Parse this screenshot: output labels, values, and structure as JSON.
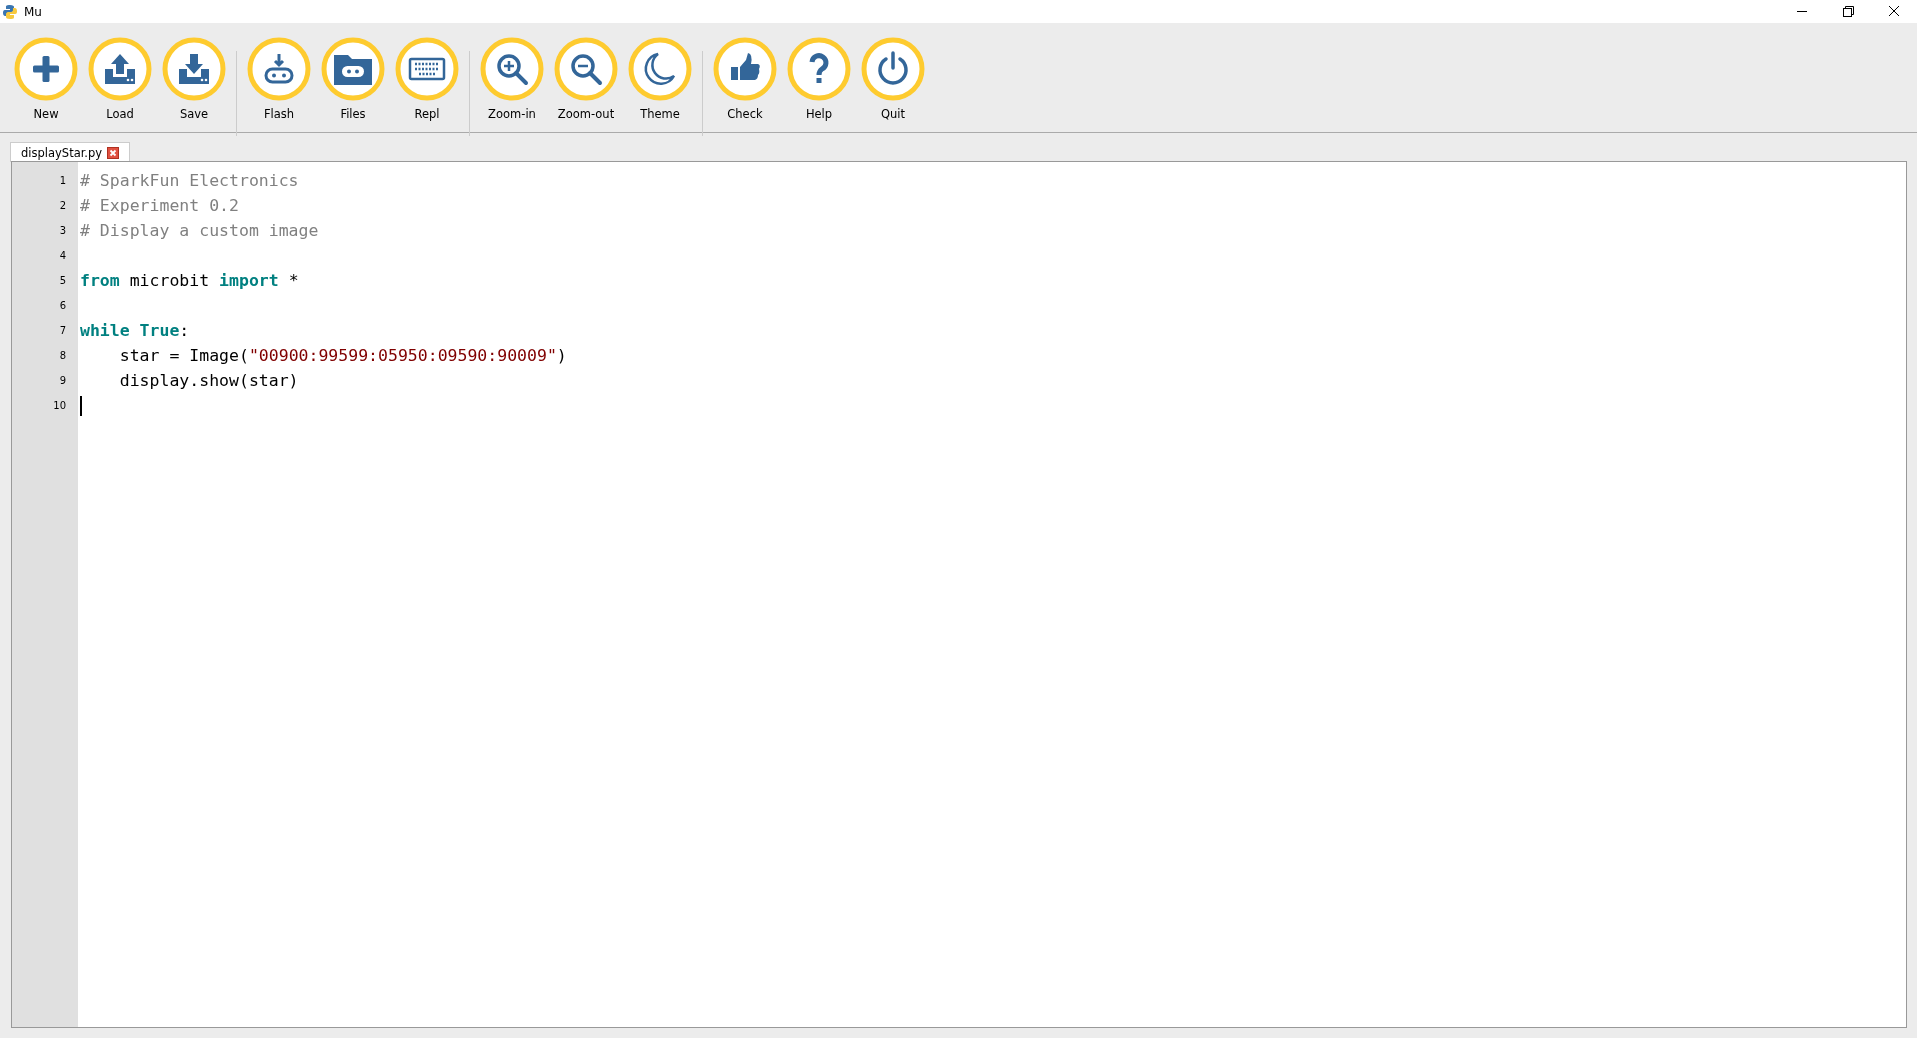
{
  "window": {
    "title": "Mu"
  },
  "toolbar": {
    "groups": [
      [
        {
          "label": "New"
        },
        {
          "label": "Load"
        },
        {
          "label": "Save"
        }
      ],
      [
        {
          "label": "Flash"
        },
        {
          "label": "Files"
        },
        {
          "label": "Repl"
        }
      ],
      [
        {
          "label": "Zoom-in"
        },
        {
          "label": "Zoom-out"
        },
        {
          "label": "Theme"
        }
      ],
      [
        {
          "label": "Check"
        },
        {
          "label": "Help"
        },
        {
          "label": "Quit"
        }
      ]
    ]
  },
  "tabs": [
    {
      "label": "displayStar.py",
      "selected": true
    }
  ],
  "editor": {
    "lines": [
      {
        "number": "1",
        "cursor": false,
        "tokens": [
          {
            "text": "# SparkFun Electronics",
            "kind": "comment"
          }
        ]
      },
      {
        "number": "2",
        "cursor": false,
        "tokens": [
          {
            "text": "# Experiment 0.2",
            "kind": "comment"
          }
        ]
      },
      {
        "number": "3",
        "cursor": false,
        "tokens": [
          {
            "text": "# Display a custom image",
            "kind": "comment"
          }
        ]
      },
      {
        "number": "4",
        "cursor": false
      },
      {
        "number": "5",
        "cursor": false,
        "tokens": [
          {
            "text": "from",
            "kind": "keyword"
          },
          {
            "text": " microbit ",
            "kind": "plain"
          },
          {
            "text": "import",
            "kind": "keyword"
          },
          {
            "text": " *",
            "kind": "plain"
          }
        ]
      },
      {
        "number": "6",
        "cursor": false
      },
      {
        "number": "7",
        "cursor": false,
        "tokens": [
          {
            "text": "while",
            "kind": "keyword"
          },
          {
            "text": " True",
            "kind": "keyword"
          },
          {
            "text": ":",
            "kind": "plain"
          }
        ]
      },
      {
        "number": "8",
        "cursor": false,
        "tokens": [
          {
            "text": "    star = Image(",
            "kind": "plain"
          },
          {
            "text": "\"00900:99599:05950:09590:90009\"",
            "kind": "string"
          },
          {
            "text": ")",
            "kind": "plain"
          }
        ]
      },
      {
        "number": "9",
        "cursor": false,
        "tokens": [
          {
            "text": "    display.show(star)",
            "kind": "plain"
          }
        ]
      },
      {
        "number": "10",
        "cursor": true
      }
    ]
  }
}
